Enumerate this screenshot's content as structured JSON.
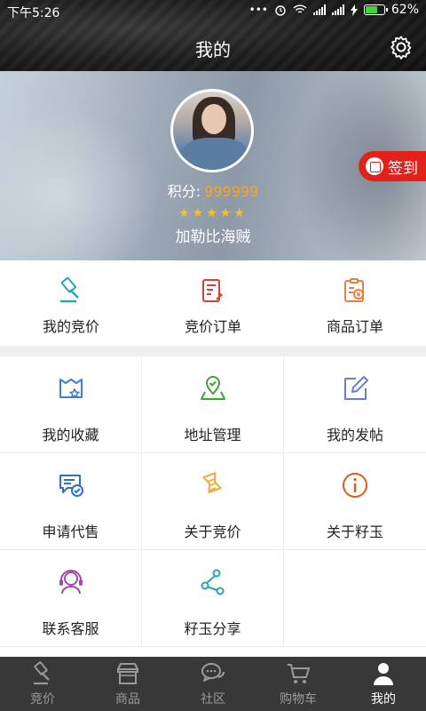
{
  "status_bar": {
    "time": "下午5:26",
    "dots": "•••",
    "battery": "62%"
  },
  "header": {
    "title": "我的"
  },
  "profile": {
    "points_label": "积分:",
    "points_value": "999999",
    "stars": "★★★★★",
    "star_count": 5,
    "username": "加勒比海贼",
    "checkin_label": "签到"
  },
  "orders": [
    {
      "label": "我的竞价",
      "icon": "gavel-icon"
    },
    {
      "label": "竞价订单",
      "icon": "bid-order-icon"
    },
    {
      "label": "商品订单",
      "icon": "product-order-icon"
    }
  ],
  "menu": [
    {
      "label": "我的收藏",
      "icon": "favorites-icon"
    },
    {
      "label": "地址管理",
      "icon": "map-pin-icon"
    },
    {
      "label": "我的发帖",
      "icon": "edit-post-icon"
    },
    {
      "label": "申请代售",
      "icon": "consignment-icon"
    },
    {
      "label": "关于竞价",
      "icon": "scroll-icon"
    },
    {
      "label": "关于籽玉",
      "icon": "info-icon"
    },
    {
      "label": "联系客服",
      "icon": "headset-icon"
    },
    {
      "label": "籽玉分享",
      "icon": "share-icon"
    }
  ],
  "nav": [
    {
      "label": "竞价",
      "icon": "gavel-icon",
      "active": false
    },
    {
      "label": "商品",
      "icon": "store-icon",
      "active": false
    },
    {
      "label": "社区",
      "icon": "chat-icon",
      "active": false
    },
    {
      "label": "购物车",
      "icon": "cart-icon",
      "active": false
    },
    {
      "label": "我的",
      "icon": "user-icon",
      "active": true
    }
  ],
  "colors": {
    "accent_red": "#e3211b",
    "points_orange": "#f6a623",
    "teal": "#2aa6a8",
    "nav_bg": "#383838"
  }
}
